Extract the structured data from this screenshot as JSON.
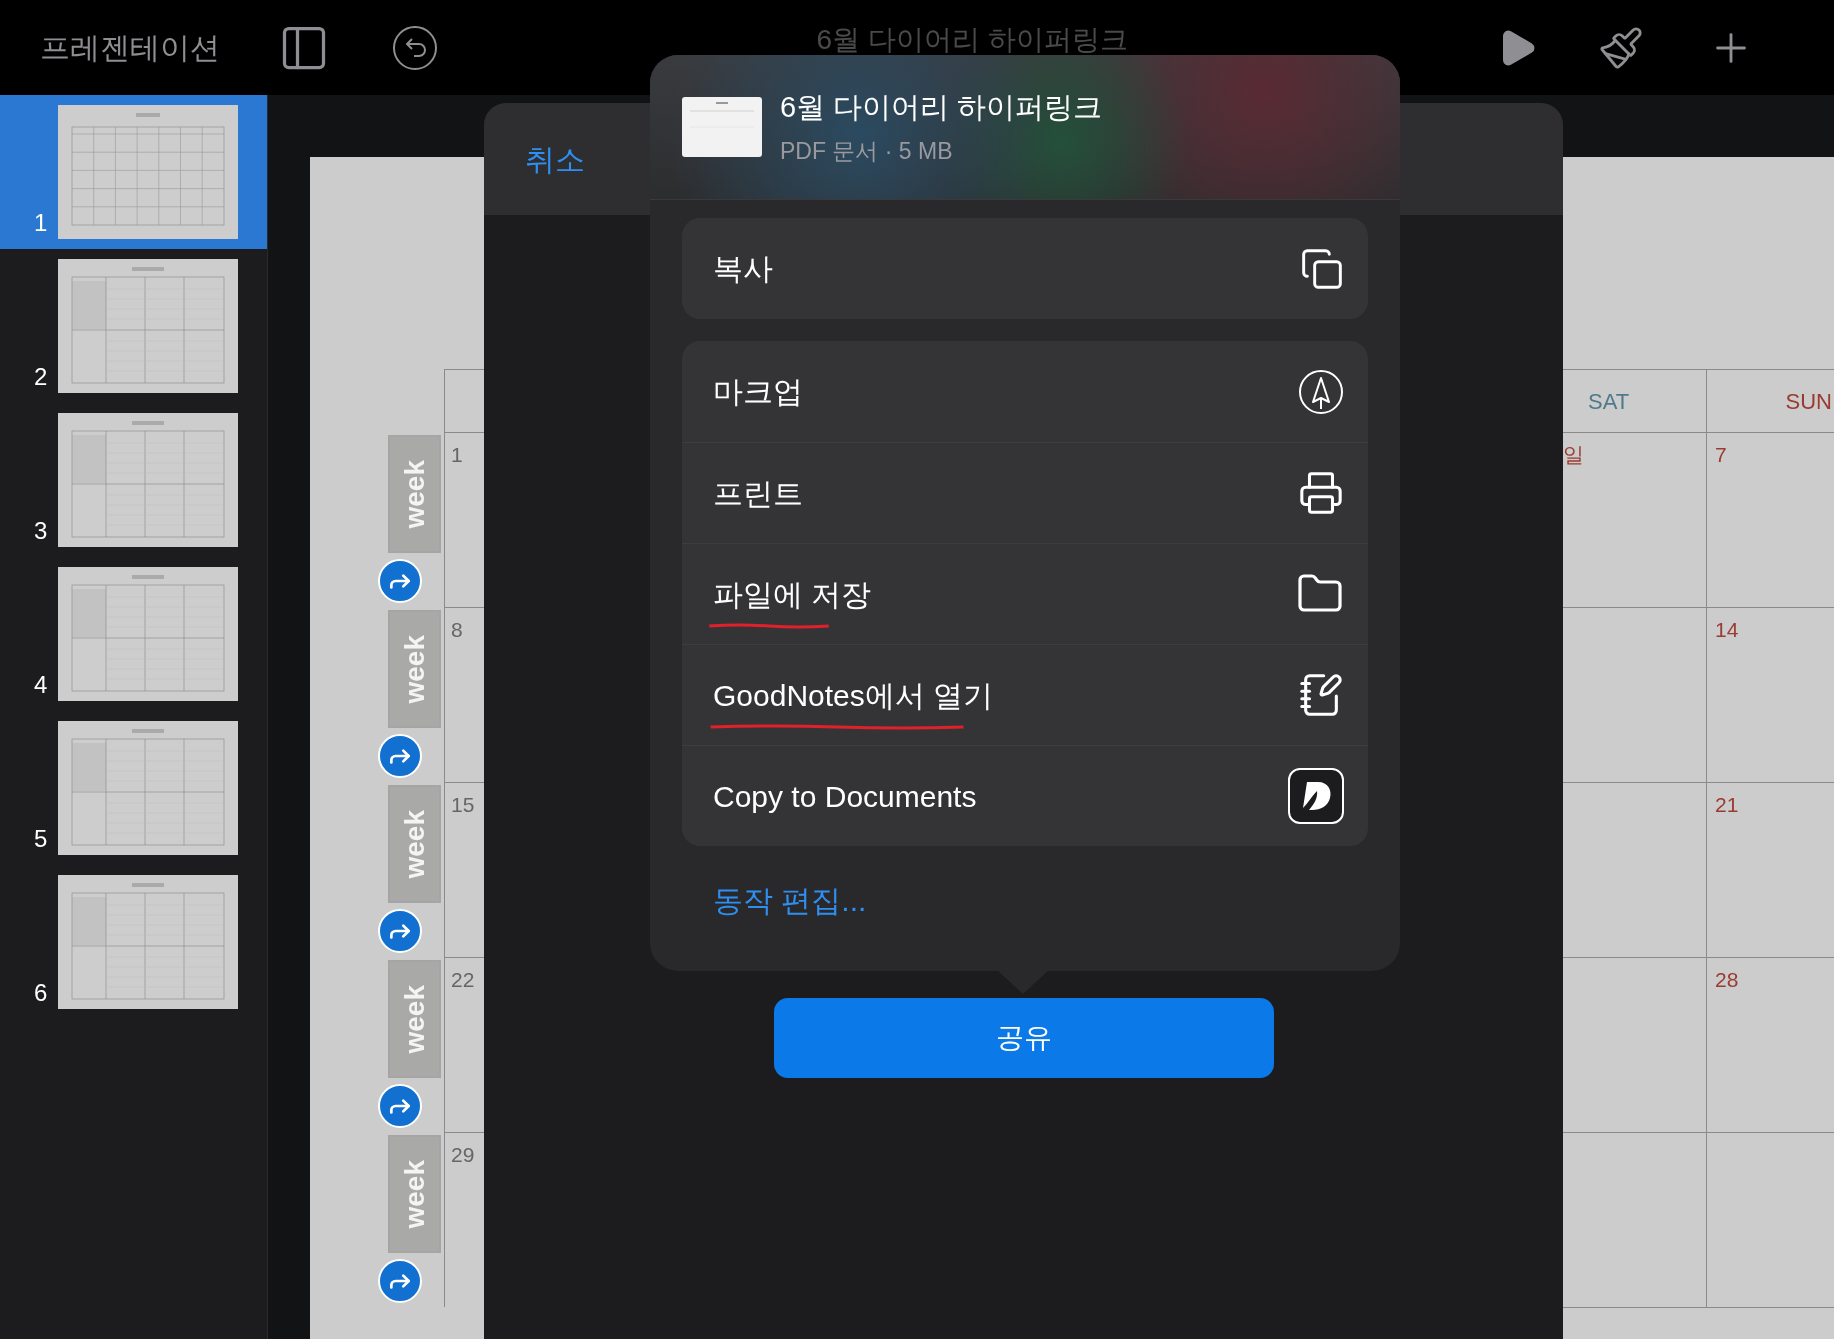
{
  "toolbar": {
    "mode_label": "프레젠테이션",
    "document_title": "6월 다이어리 하이퍼링크"
  },
  "slides": [
    {
      "number": "1",
      "selected": true,
      "kind": "monthly"
    },
    {
      "number": "2",
      "selected": false,
      "kind": "weekly"
    },
    {
      "number": "3",
      "selected": false,
      "kind": "weekly"
    },
    {
      "number": "4",
      "selected": false,
      "kind": "weekly"
    },
    {
      "number": "5",
      "selected": false,
      "kind": "weekly"
    },
    {
      "number": "6",
      "selected": false,
      "kind": "weekly"
    }
  ],
  "calendar": {
    "headers": [
      "SAT",
      "SUN"
    ],
    "saturday_fragment": "일",
    "weeks": [
      {
        "tab": "week",
        "start_date": "1",
        "sunday": "7"
      },
      {
        "tab": "week",
        "start_date": "8",
        "sunday": "14"
      },
      {
        "tab": "week",
        "start_date": "15",
        "sunday": "21"
      },
      {
        "tab": "week",
        "start_date": "22",
        "sunday": "28"
      },
      {
        "tab": "week",
        "start_date": "29"
      }
    ]
  },
  "dialog": {
    "cancel": "취소"
  },
  "share_sheet": {
    "title": "6월 다이어리 하이퍼링크",
    "subtitle": "PDF 문서 · 5 MB",
    "groups": [
      [
        {
          "label": "복사",
          "kind": "copy",
          "underlined": false
        }
      ],
      [
        {
          "label": "마크업",
          "kind": "markup",
          "underlined": false
        },
        {
          "label": "프린트",
          "kind": "print",
          "underlined": false
        },
        {
          "label": "파일에 저장",
          "kind": "folder",
          "underlined": true
        },
        {
          "label": "GoodNotes에서 열기",
          "kind": "note",
          "underlined": true
        },
        {
          "label": "Copy to Documents",
          "kind": "documents",
          "underlined": false
        }
      ]
    ],
    "edit_actions": "동작 편집..."
  },
  "share_button": "공유"
}
